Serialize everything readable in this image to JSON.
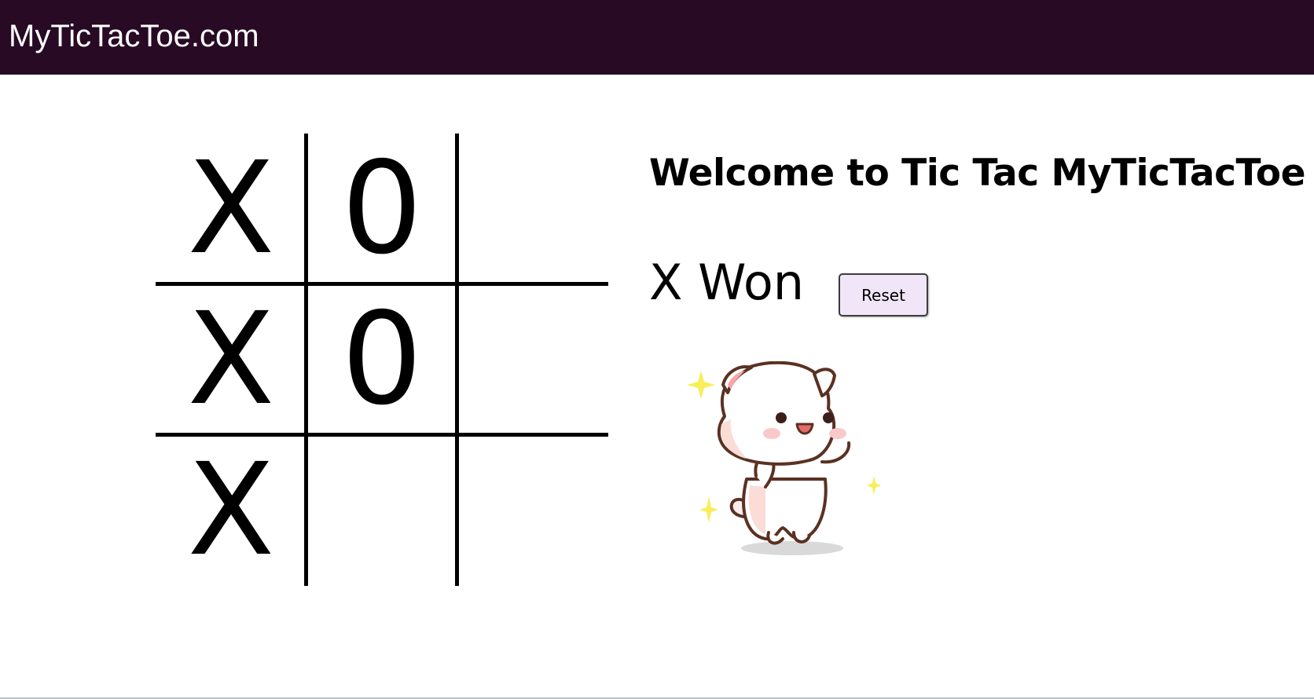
{
  "header": {
    "title": "MyTicTacToe.com"
  },
  "board": {
    "cells": [
      "X",
      "0",
      "",
      "X",
      "0",
      "",
      "X",
      "",
      ""
    ]
  },
  "main": {
    "welcome": "Welcome to Tic Tac MyTicTacToe",
    "status": "X Won",
    "reset_label": "Reset",
    "celebration_icon": "happy-cat-sticker"
  },
  "colors": {
    "header_bg": "#280a25",
    "header_text": "#ffffff",
    "button_bg": "#f1e6f7",
    "sparkle": "#f7ee5a"
  }
}
